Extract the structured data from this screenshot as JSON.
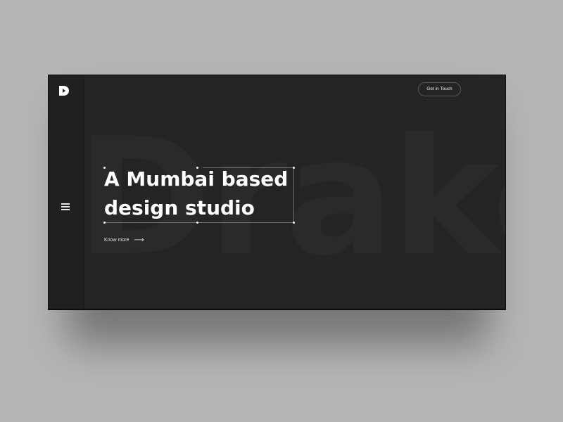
{
  "brand": {
    "logo_icon": "drake-logo-icon",
    "watermark": "Drake"
  },
  "header": {
    "cta_label": "Get in Touch"
  },
  "sidebar": {
    "menu_icon": "hamburger-menu-icon"
  },
  "hero": {
    "headline_line1": "A Mumbai based",
    "headline_line2": "design studio",
    "know_more_label": "Know more",
    "arrow_icon": "arrow-right-icon"
  },
  "colors": {
    "background": "#b5b5b5",
    "window": "#242424",
    "sidebar": "#202020",
    "text": "#ffffff"
  }
}
